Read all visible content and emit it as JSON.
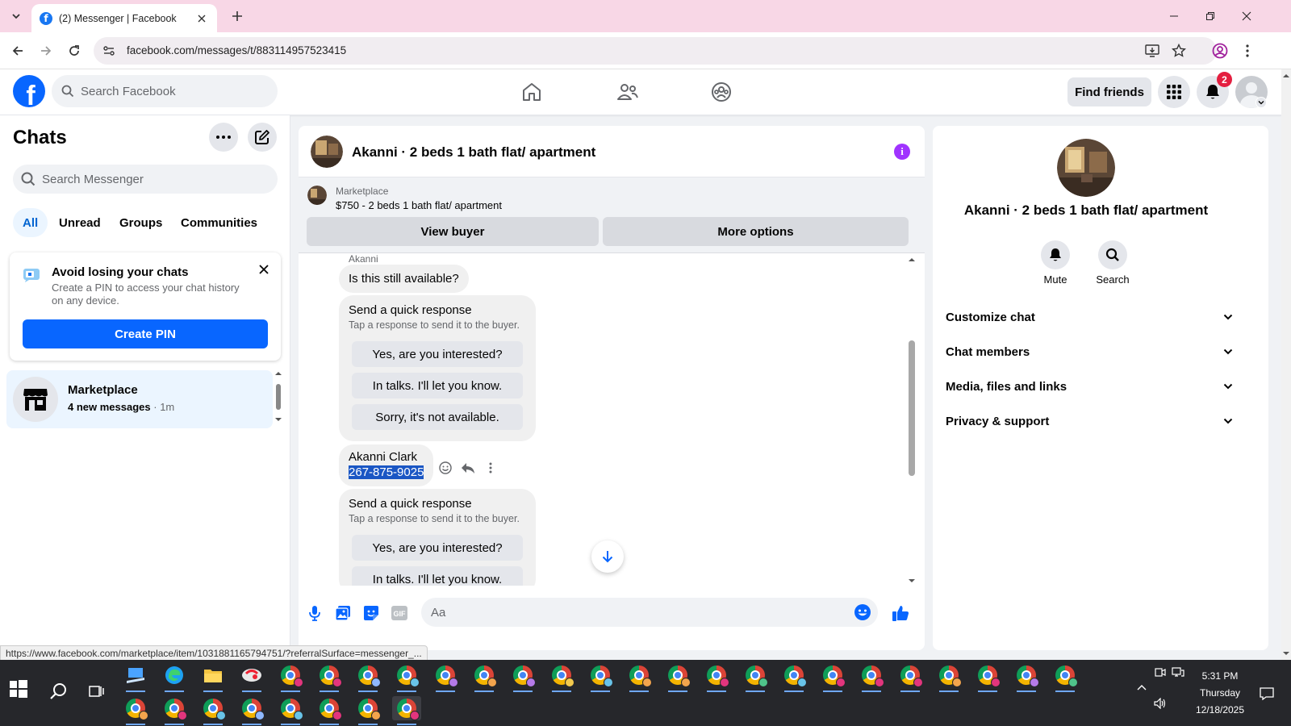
{
  "browser": {
    "tab_title": "(2) Messenger | Facebook",
    "url": "facebook.com/messages/t/883114957523415",
    "status_link": "https://www.facebook.com/marketplace/item/1031881165794751/?referralSurface=messenger_..."
  },
  "header": {
    "search_placeholder": "Search Facebook",
    "find_friends": "Find friends",
    "notification_count": "2",
    "brand_color": "#0866ff"
  },
  "sidebar": {
    "title": "Chats",
    "search_placeholder": "Search Messenger",
    "filters": [
      "All",
      "Unread",
      "Groups",
      "Communities"
    ],
    "pin_card": {
      "title": "Avoid losing your chats",
      "subtitle": "Create a PIN to access your chat history on any device.",
      "button": "Create PIN"
    },
    "conversation": {
      "name": "Marketplace",
      "preview": "4 new messages",
      "time": "· 1m"
    }
  },
  "chat": {
    "title": "Akanni · 2 beds 1 bath flat/ apartment",
    "marketplace_label": "Marketplace",
    "listing": "$750 - 2 beds 1 bath flat/ apartment",
    "view_buyer": "View buyer",
    "more_options": "More options",
    "messages": {
      "sender": "Akanni",
      "first": "Is this still available?",
      "quick_title": "Send a quick response",
      "quick_subtitle": "Tap a response to send it to the buyer.",
      "quick_options": [
        "Yes, are you interested?",
        "In talks. I'll let you know.",
        "Sorry, it's not available."
      ],
      "contact_name": "Akanni Clark",
      "contact_phone": "267-875-9025"
    },
    "composer_placeholder": "Aa",
    "accent_color": "#0866ff"
  },
  "info_panel": {
    "name": "Akanni · 2 beds 1 bath flat/ apartment",
    "mute": "Mute",
    "search": "Search",
    "sections": [
      "Customize chat",
      "Chat members",
      "Media, files and links",
      "Privacy & support"
    ]
  },
  "taskbar": {
    "time": "5:31 PM",
    "day": "Thursday",
    "date": "12/18/2025"
  }
}
